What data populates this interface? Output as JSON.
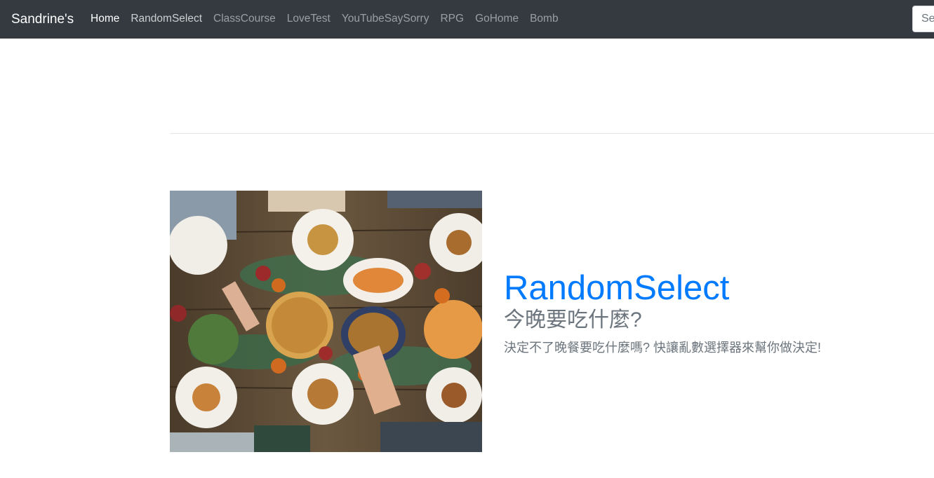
{
  "navbar": {
    "brand": "Sandrine's",
    "links": [
      {
        "label": "Home",
        "state": "active"
      },
      {
        "label": "RandomSelect",
        "state": "hover"
      },
      {
        "label": "ClassCourse",
        "state": "normal"
      },
      {
        "label": "LoveTest",
        "state": "normal"
      },
      {
        "label": "YouTubeSaySorry",
        "state": "normal"
      },
      {
        "label": "RPG",
        "state": "normal"
      },
      {
        "label": "GoHome",
        "state": "normal"
      },
      {
        "label": "Bomb",
        "state": "normal"
      }
    ],
    "search": {
      "placeholder": "Search",
      "value": ""
    }
  },
  "feature": {
    "image_alt": "food",
    "title": "RandomSelect",
    "subtitle": "今晚要吃什麼?",
    "description": "決定不了晚餐要吃什麼嗎? 快讓亂數選擇器來幫你做決定!"
  },
  "colors": {
    "navbar_bg": "#343a40",
    "accent": "#007bff",
    "muted_text": "#6c757d"
  }
}
